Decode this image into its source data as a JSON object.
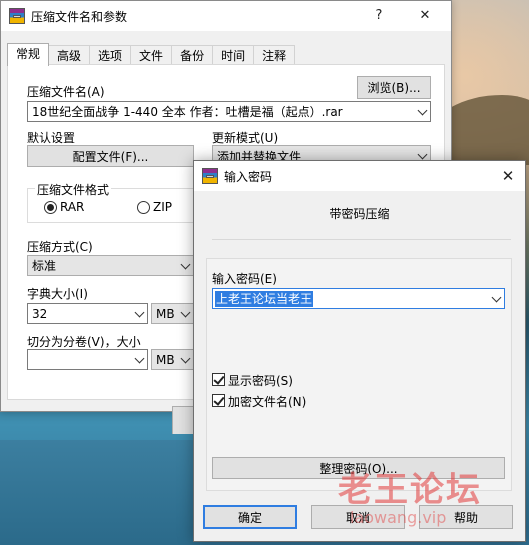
{
  "main_dialog": {
    "title": "压缩文件名和参数",
    "help_button": "?",
    "close_button": "✕",
    "tabs": [
      "常规",
      "高级",
      "选项",
      "文件",
      "备份",
      "时间",
      "注释"
    ],
    "archive_name_label": "压缩文件名(A)",
    "browse_button": "浏览(B)...",
    "archive_name_value": "18世纪全面战争 1-440 全本 作者：吐槽是福（起点）.rar",
    "default_settings_label": "默认设置",
    "profiles_button": "配置文件(F)...",
    "update_mode_label": "更新模式(U)",
    "update_mode_value": "添加并替换文件",
    "archive_format_label": "压缩文件格式",
    "format_rar": "RAR",
    "format_zip": "ZIP",
    "compression_method_label": "压缩方式(C)",
    "compression_method_value": "标准",
    "dictionary_size_label": "字典大小(I)",
    "dictionary_size_value": "32",
    "dictionary_unit": "MB",
    "split_label": "切分为分卷(V)，大小",
    "split_value": "",
    "split_unit": "MB"
  },
  "password_dialog": {
    "title": "输入密码",
    "close_button": "✕",
    "heading": "带密码压缩",
    "enter_password_label": "输入密码(E)",
    "password_value": "上老王论坛当老王",
    "show_password_label": "显示密码(S)",
    "show_password_checked": true,
    "encrypt_names_label": "加密文件名(N)",
    "encrypt_names_checked": true,
    "organize_button": "整理密码(O)...",
    "ok_button": "确定",
    "cancel_button": "取消",
    "help_button": "帮助"
  },
  "watermark": {
    "text": "老王论坛",
    "url_text": "laowang.vip"
  },
  "colors": {
    "accent": "#2f7de1",
    "dialog_bg": "#f0f0f0",
    "watermark": "#e23a3a"
  }
}
